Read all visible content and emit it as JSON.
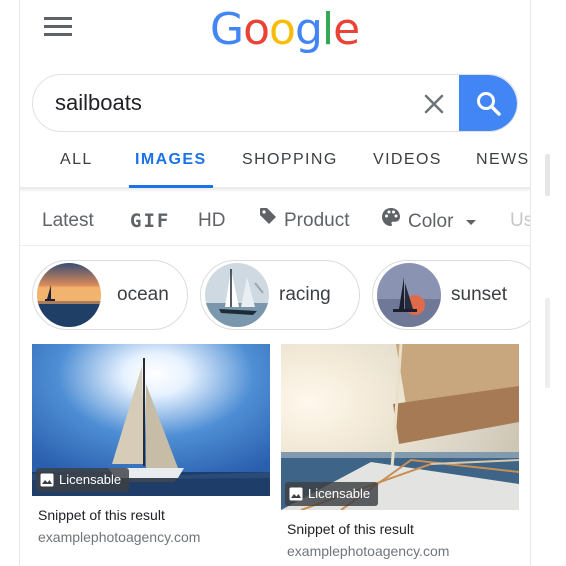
{
  "header": {
    "menu_icon": "hamburger-menu-icon",
    "logo_letters": [
      {
        "char": "G",
        "color": "#4285F4"
      },
      {
        "char": "o",
        "color": "#EA4335"
      },
      {
        "char": "o",
        "color": "#FBBC05"
      },
      {
        "char": "g",
        "color": "#4285F4"
      },
      {
        "char": "l",
        "color": "#34A853"
      },
      {
        "char": "e",
        "color": "#EA4335"
      }
    ]
  },
  "search": {
    "query": "sailboats",
    "clear_icon": "close-icon",
    "search_icon": "search-icon",
    "button_color": "#4285F4"
  },
  "tabs": [
    {
      "label": "ALL",
      "active": false
    },
    {
      "label": "IMAGES",
      "active": true
    },
    {
      "label": "SHOPPING",
      "active": false
    },
    {
      "label": "VIDEOS",
      "active": false
    },
    {
      "label": "NEWS",
      "active": false
    }
  ],
  "filters": {
    "latest": "Latest",
    "gif": "GIF",
    "hd": "HD",
    "product": "Product",
    "product_icon": "tag-icon",
    "color": "Color",
    "color_icon": "palette-icon",
    "color_dropdown_icon": "caret-down-icon",
    "usage_partial": "Us"
  },
  "chips": [
    {
      "label": "ocean"
    },
    {
      "label": "racing"
    },
    {
      "label": "sunset"
    }
  ],
  "results": [
    {
      "badge": "Licensable",
      "badge_icon": "image-icon",
      "snippet": "Snippet of this result",
      "domain": "examplephotoagency.com"
    },
    {
      "badge": "Licensable",
      "badge_icon": "image-icon",
      "snippet": "Snippet of this result",
      "domain": "examplephotoagency.com"
    }
  ],
  "colors": {
    "accent": "#1A73E8",
    "text": "#202124",
    "secondary_text": "#70757A"
  }
}
